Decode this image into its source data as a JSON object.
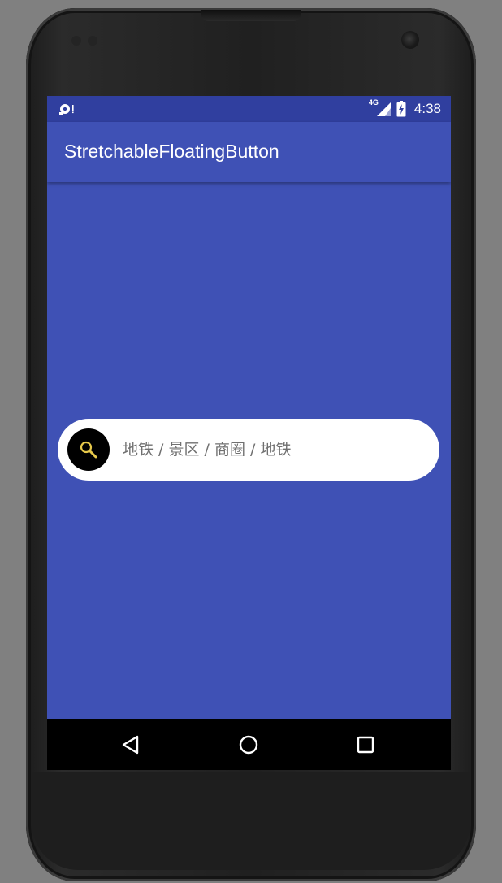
{
  "status_bar": {
    "network": "4G",
    "time": "4:38",
    "icons": [
      "notification-app-icon",
      "signal-4g-icon",
      "battery-charging-icon"
    ]
  },
  "app_bar": {
    "title": "StretchableFloatingButton"
  },
  "search": {
    "placeholder_text": "地铁 / 景区 / 商圈 / 地铁",
    "icon": "search-icon",
    "button_color": "#000000",
    "icon_color": "#e6c84a"
  },
  "nav_bar": {
    "buttons": [
      "back-icon",
      "home-icon",
      "recents-icon"
    ]
  },
  "colors": {
    "primary": "#3f51b5",
    "primary_dark": "#303f9f",
    "pill_background": "#ffffff"
  }
}
